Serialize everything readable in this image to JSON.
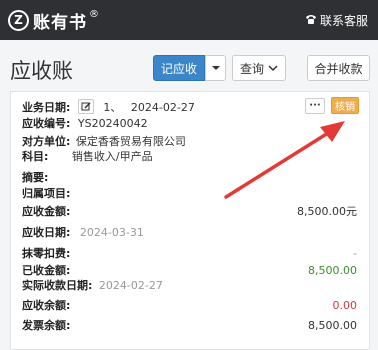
{
  "header": {
    "logo_mark": "Z",
    "logo_text": "账有书",
    "logo_reg": "®",
    "support_label": "联系客服"
  },
  "page": {
    "title": "应收账",
    "record_button": "记应收",
    "query_button": "查询",
    "merge_button": "合并收款"
  },
  "record": {
    "business_date_label": "业务日期:",
    "seq": "1、",
    "business_date": "2024-02-27",
    "more_label": "···",
    "verify_label": "核销",
    "code_label": "应收编号:",
    "code": "YS20240042",
    "party_label": "对方单位:",
    "party": "保定香香贸易有限公司",
    "subject_label": "科目:",
    "subject": "销售收入/甲产品",
    "summary_label": "摘要:",
    "project_label": "归属项目:",
    "amount_label": "应收金额:",
    "amount": "8,500.00元",
    "due_date_label": "应收日期:",
    "due_date": "2024-03-31",
    "writeoff_label": "抹零扣费:",
    "writeoff": "-",
    "received_label": "已收金额:",
    "received": "8,500.00",
    "actual_date_label": "实际收款日期:",
    "actual_date": "2024-02-27",
    "balance_label": "应收余额:",
    "balance": "0.00",
    "invoice_balance_label": "发票余额:",
    "invoice_balance": "8,500.00"
  },
  "colors": {
    "topbar": "#2e3033",
    "primary": "#3a86c8",
    "verify": "#f0ad4e",
    "arrow": "#e53935",
    "green": "#3b8f2e",
    "red": "#d9363e"
  }
}
